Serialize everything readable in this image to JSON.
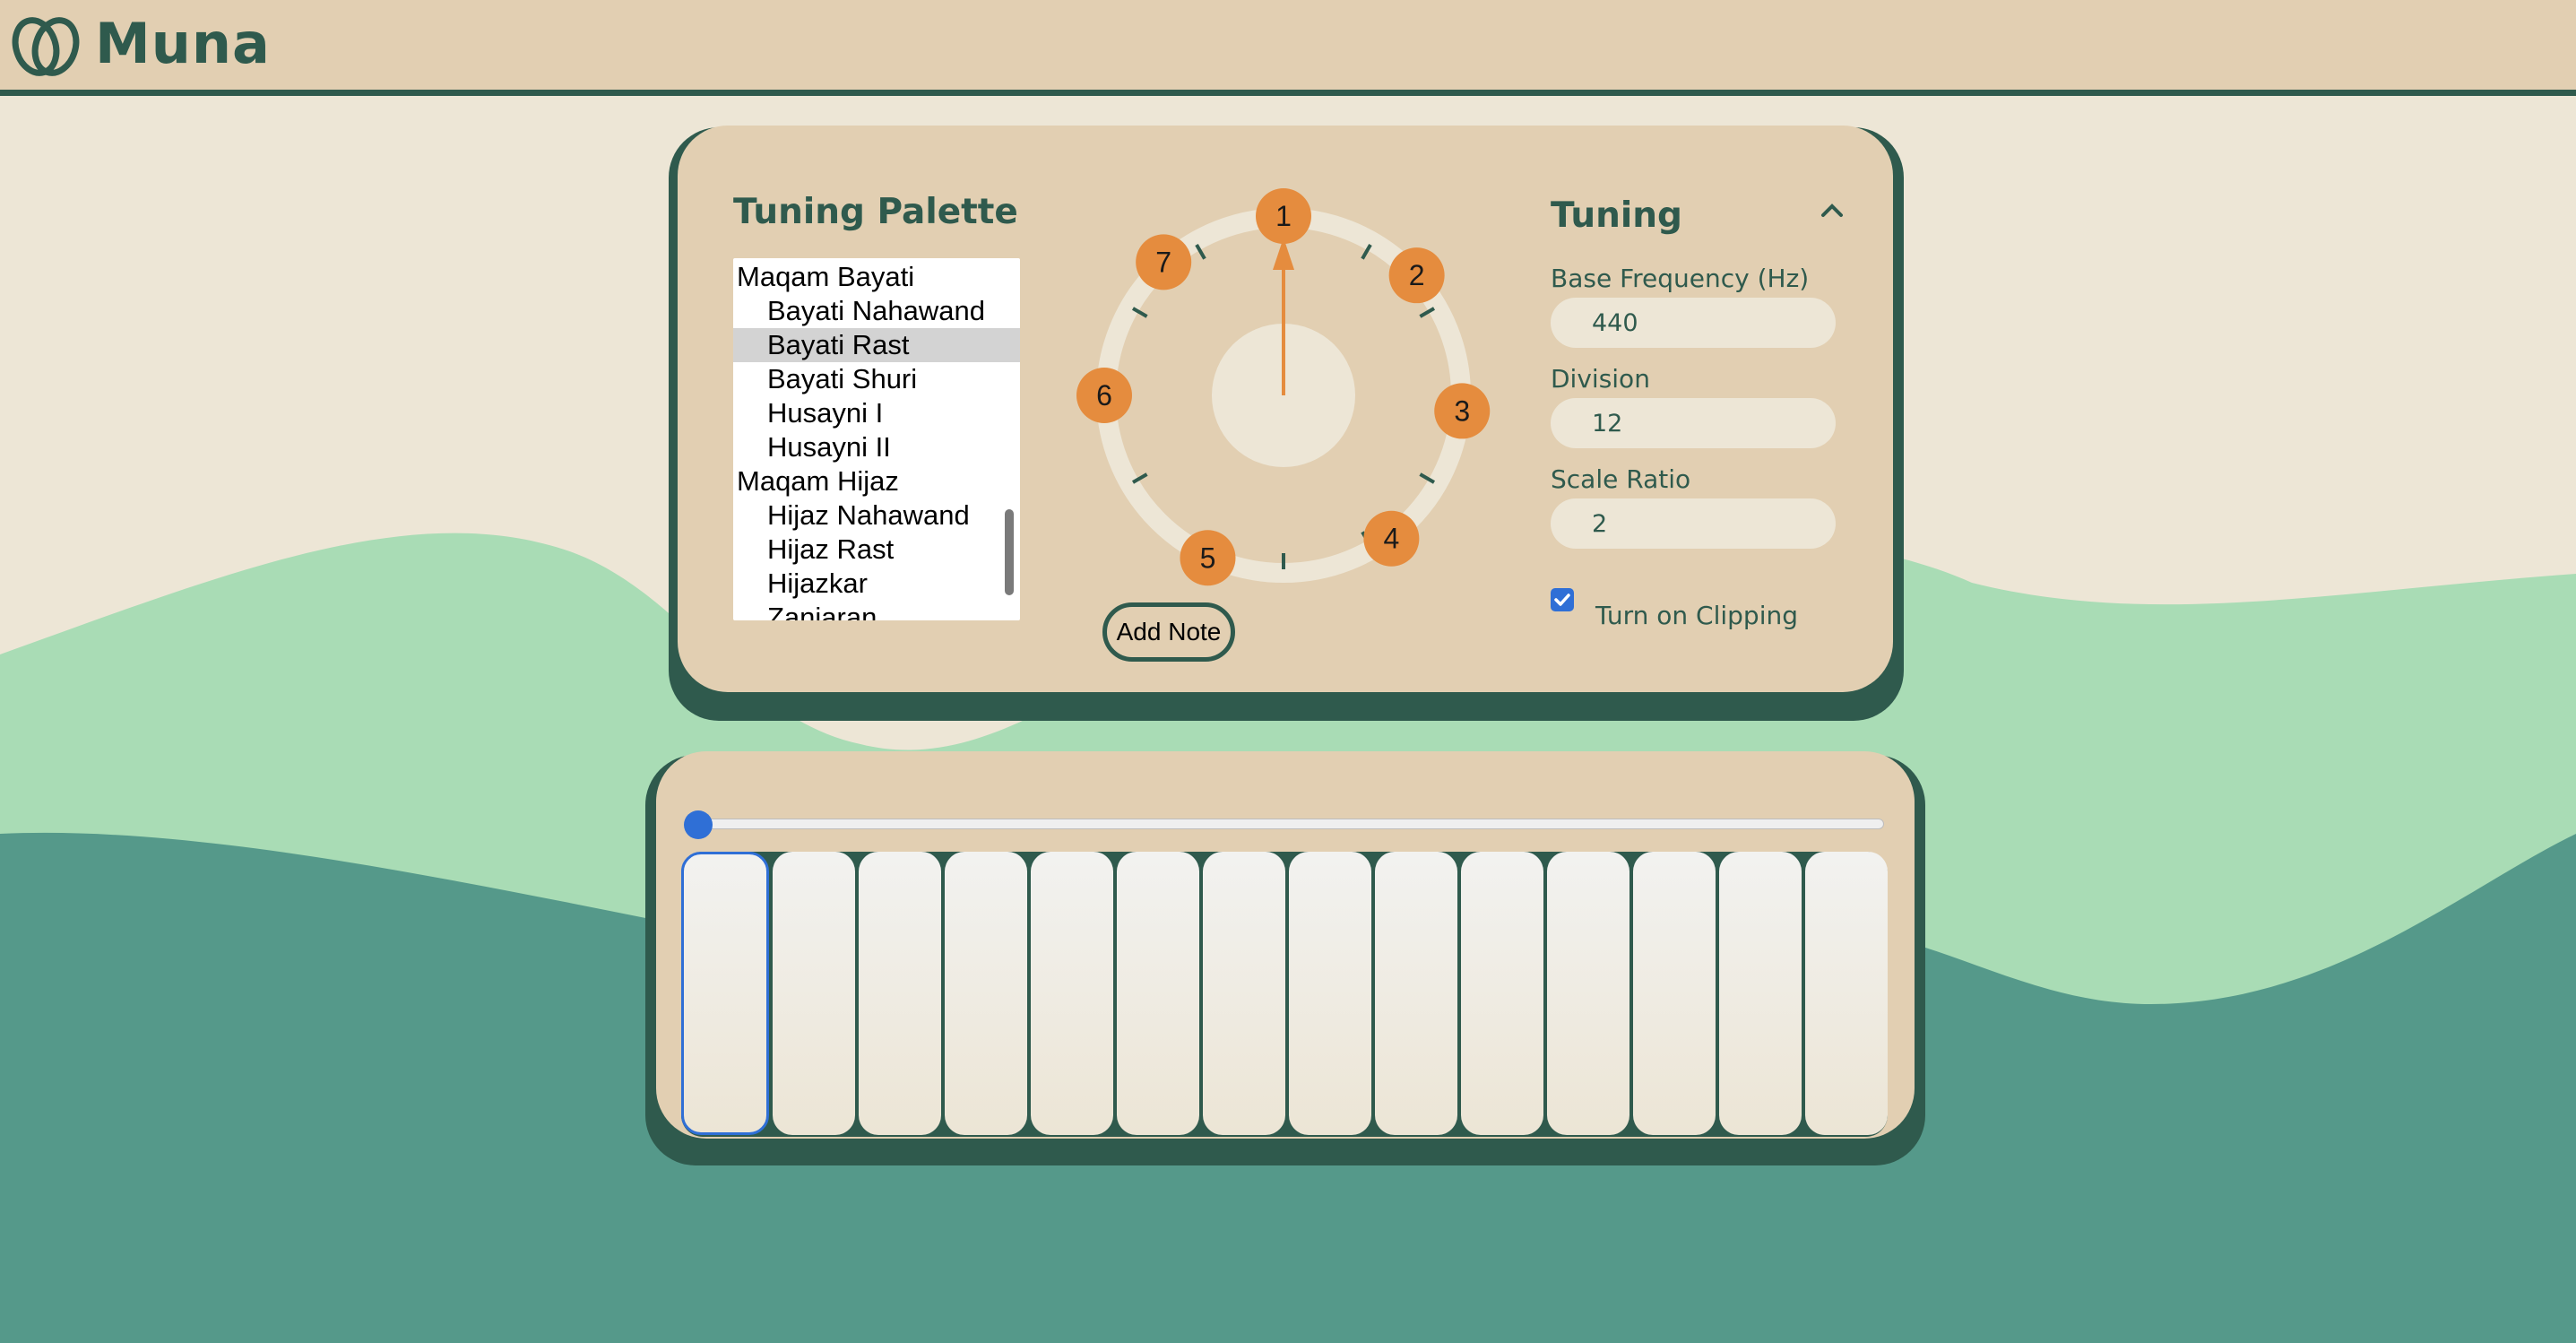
{
  "app": {
    "name": "Muna"
  },
  "colors": {
    "brand": "#2f5a4d",
    "panel": "#e2cfb2",
    "cream": "#ede6d6",
    "note": "#e58c3e",
    "hill_light": "#a9dcb5",
    "hill_dark": "#55998a",
    "accent": "#2f6fd6"
  },
  "palette": {
    "title": "Tuning Palette",
    "items": [
      {
        "label": "Maqam Bayati",
        "kind": "group"
      },
      {
        "label": "Bayati Nahawand",
        "kind": "option"
      },
      {
        "label": "Bayati Rast",
        "kind": "option",
        "selected": true
      },
      {
        "label": "Bayati Shuri",
        "kind": "option"
      },
      {
        "label": "Husayni I",
        "kind": "option"
      },
      {
        "label": "Husayni II",
        "kind": "option"
      },
      {
        "label": "Maqam Hijaz",
        "kind": "group"
      },
      {
        "label": "Hijaz Nahawand",
        "kind": "option"
      },
      {
        "label": "Hijaz Rast",
        "kind": "option"
      },
      {
        "label": "Hijazkar",
        "kind": "option"
      },
      {
        "label": "Zanjaran",
        "kind": "option"
      }
    ]
  },
  "dial": {
    "notes": [
      "1",
      "2",
      "3",
      "4",
      "5",
      "6",
      "7"
    ],
    "add_note_label": "Add Note"
  },
  "tuning": {
    "title": "Tuning",
    "base_frequency": {
      "label": "Base Frequency (Hz)",
      "value": "440"
    },
    "division": {
      "label": "Division",
      "value": "12"
    },
    "scale_ratio": {
      "label": "Scale Ratio",
      "value": "2"
    },
    "clipping": {
      "label": "Turn on Clipping",
      "checked": true
    }
  },
  "keyboard": {
    "key_count": 14,
    "active_key": 0,
    "slider_value": 0
  }
}
